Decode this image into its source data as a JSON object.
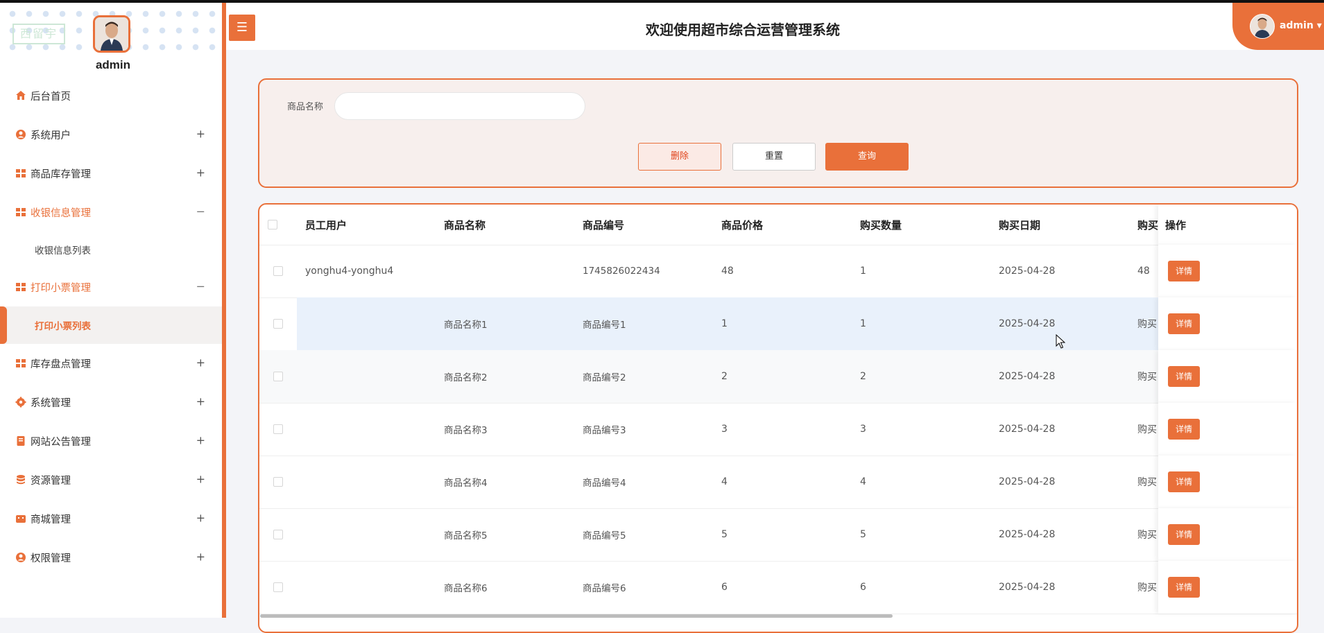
{
  "app": {
    "title": "欢迎使用超市综合运营管理系统",
    "username": "admin",
    "header_user": "admin",
    "logo_text": "西留宇",
    "accent": "#e9703a"
  },
  "sidebar": {
    "items": [
      {
        "label": "后台首页",
        "icon": "home-icon",
        "expand": ""
      },
      {
        "label": "系统用户",
        "icon": "user-icon",
        "expand": "+"
      },
      {
        "label": "商品库存管理",
        "icon": "grid-icon",
        "expand": "+"
      },
      {
        "label": "收银信息管理",
        "icon": "grid-icon",
        "expand": "−",
        "sub": [
          "收银信息列表"
        ]
      },
      {
        "label": "打印小票管理",
        "icon": "grid-icon",
        "expand": "−",
        "sub": [
          "打印小票列表"
        ]
      },
      {
        "label": "库存盘点管理",
        "icon": "grid-icon",
        "expand": "+"
      },
      {
        "label": "系统管理",
        "icon": "gear-icon",
        "expand": "+"
      },
      {
        "label": "网站公告管理",
        "icon": "document-icon",
        "expand": "+"
      },
      {
        "label": "资源管理",
        "icon": "database-icon",
        "expand": "+"
      },
      {
        "label": "商城管理",
        "icon": "shop-icon",
        "expand": "+"
      },
      {
        "label": "权限管理",
        "icon": "user-icon",
        "expand": "+"
      }
    ]
  },
  "search": {
    "label": "商品名称",
    "value": "",
    "delete_label": "删除",
    "reset_label": "重置",
    "query_label": "查询"
  },
  "table": {
    "headers": [
      "员工用户",
      "商品名称",
      "商品编号",
      "商品价格",
      "购买数量",
      "购买日期",
      "购买",
      "操作"
    ],
    "rows": [
      [
        "yonghu4-yonghu4",
        "",
        "1745826022434",
        "48",
        "1",
        "2025-04-28",
        "48"
      ],
      [
        "",
        "商品名称1",
        "商品编号1",
        "1",
        "1",
        "2025-04-28",
        "购买"
      ],
      [
        "",
        "商品名称2",
        "商品编号2",
        "2",
        "2",
        "2025-04-28",
        "购买"
      ],
      [
        "",
        "商品名称3",
        "商品编号3",
        "3",
        "3",
        "2025-04-28",
        "购买"
      ],
      [
        "",
        "商品名称4",
        "商品编号4",
        "4",
        "4",
        "2025-04-28",
        "购买"
      ],
      [
        "",
        "商品名称5",
        "商品编号5",
        "5",
        "5",
        "2025-04-28",
        "购买"
      ],
      [
        "",
        "商品名称6",
        "商品编号6",
        "6",
        "6",
        "2025-04-28",
        "购买"
      ]
    ],
    "detail_label": "详情"
  }
}
